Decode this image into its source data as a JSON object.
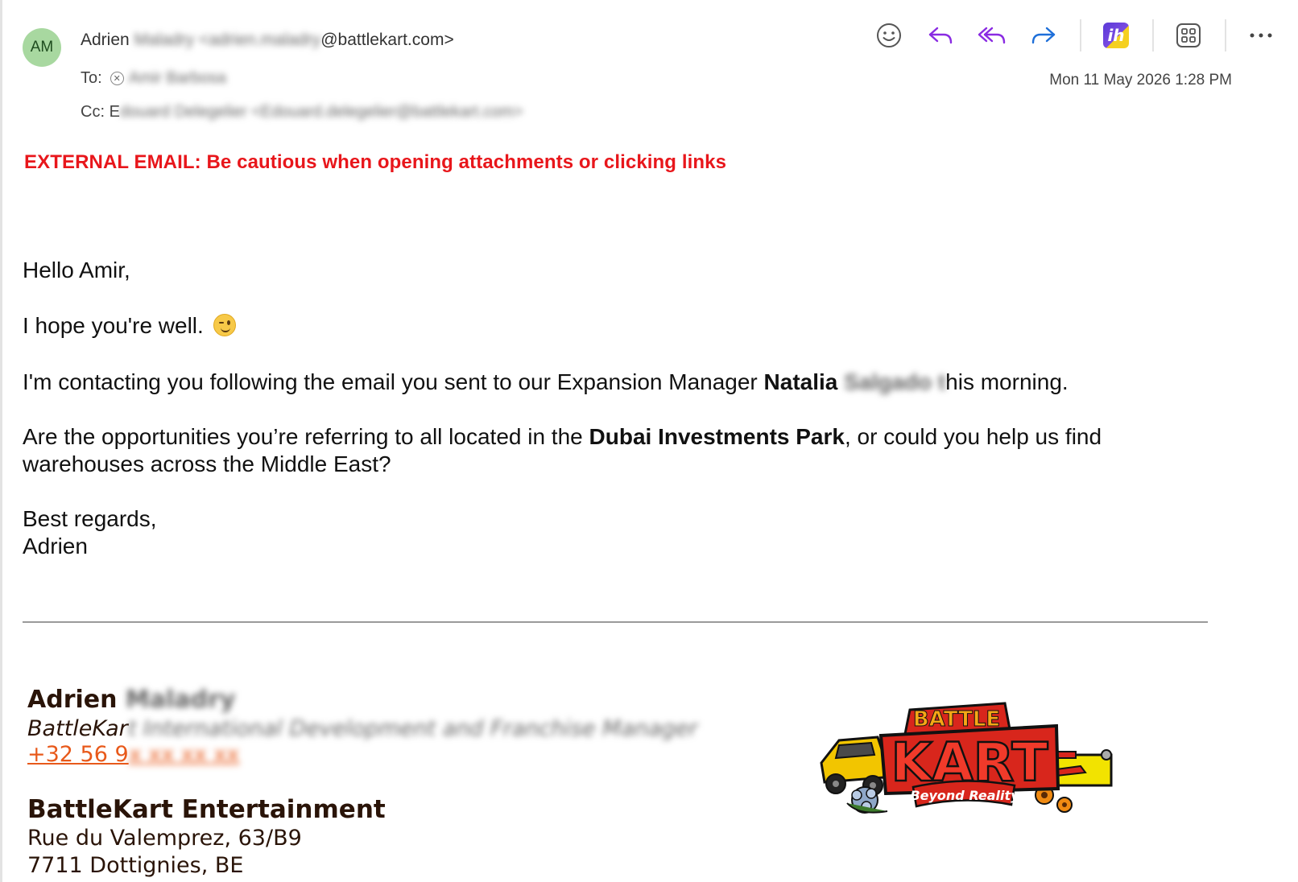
{
  "header": {
    "avatar_initials": "AM",
    "from_name": "Adrien",
    "from_hidden": " Maladry <adrien.maladry",
    "from_domain": "@battlekart.com>",
    "to_label": "To:",
    "to_hidden": "Amir Barbosa",
    "cc_label": "Cc:",
    "cc_visible": "E",
    "cc_hidden": "douard Delegelier <Edouard.delegelier@battlekart.com>",
    "timestamp": "Mon 11 May 2026 1:28 PM"
  },
  "toolbar": {
    "icons": [
      "emoji-icon",
      "reply-icon",
      "reply-all-icon",
      "forward-icon",
      "app-icon",
      "apps-grid-icon",
      "more-icon"
    ],
    "app_glyph": "ih"
  },
  "warning": "EXTERNAL EMAIL: Be cautious when opening attachments or clicking links",
  "body": {
    "greeting": "Hello Amir,",
    "line1": "I hope you're well.",
    "line2_pre": "I'm contacting you following the email you sent to our Expansion Manager ",
    "line2_bold": "Natalia",
    "line2_hidden": " Salgado t",
    "line2_post": "his morning.",
    "line3_pre": "Are the opportunities you’re referring to all located in the ",
    "line3_bold": "Dubai Investments Park",
    "line3_post": ", or could you help us find",
    "line3_cont": "warehouses across the Middle East?",
    "closing": "Best regards,",
    "signoff": "Adrien"
  },
  "signature": {
    "name": "Adrien",
    "name_hidden": " Maladry",
    "title_visible": "BattleKar",
    "title_hidden": "t International Development and Franchise Manager",
    "phone_visible": "+32 56 9",
    "phone_hidden": "x xx xx xx",
    "company": "BattleKart Entertainment",
    "address": "Rue du Valemprez, 63/B9",
    "address2": "7711 Dottignies, BE"
  },
  "logo": {
    "top": "BATTLE",
    "main": "KART",
    "tagline": "Beyond Reality"
  },
  "colors": {
    "warning": "#e8161b",
    "avatar_bg": "#a8d8a0",
    "reply_purple": "#8a2be2",
    "forward_blue": "#1e6fd9",
    "signature_link": "#e8591a"
  }
}
